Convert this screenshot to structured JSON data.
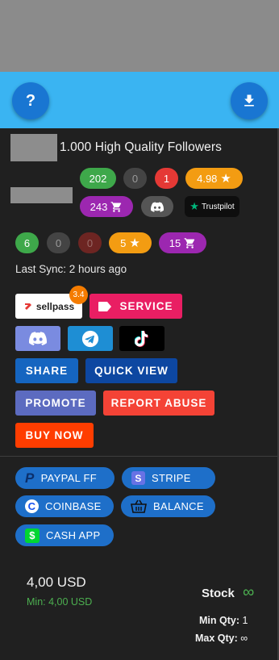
{
  "product": {
    "title": "1.000 High Quality Followers"
  },
  "stats_row1": {
    "green": "202",
    "gray": "0",
    "red": "1",
    "rating": "4.98"
  },
  "stats_row2": {
    "cart": "243",
    "trustpilot": "Trustpilot"
  },
  "stats_row3": {
    "green": "6",
    "gray": "0",
    "darkred": "0",
    "rating": "5",
    "cart": "15"
  },
  "sync": {
    "text": "Last Sync: 2 hours ago"
  },
  "sellpass": {
    "label": "sellpass",
    "badge": "3.4"
  },
  "buttons": {
    "service": "SERVICE",
    "share": "SHARE",
    "quick_view": "QUICK VIEW",
    "promote": "PROMOTE",
    "report_abuse": "REPORT ABUSE",
    "buy_now": "BUY NOW"
  },
  "payments": {
    "paypal": "PAYPAL FF",
    "stripe": "STRIPE",
    "coinbase": "COINBASE",
    "balance": "BALANCE",
    "cashapp": "CASH APP"
  },
  "pricing": {
    "price": "4,00 USD",
    "min": "Min: 4,00 USD",
    "stock_label": "Stock",
    "infinity": "∞",
    "min_qty_label": "Min Qty:",
    "min_qty_value": "1",
    "max_qty_label": "Max Qty:",
    "max_qty_value": "∞"
  },
  "colors": {
    "accent_blue": "#3ab4f2",
    "fab_blue": "#1976d2",
    "panel": "#202020",
    "service_pink": "#e91e63",
    "report_red": "#f44336",
    "buy_orange": "#ff3d00"
  }
}
